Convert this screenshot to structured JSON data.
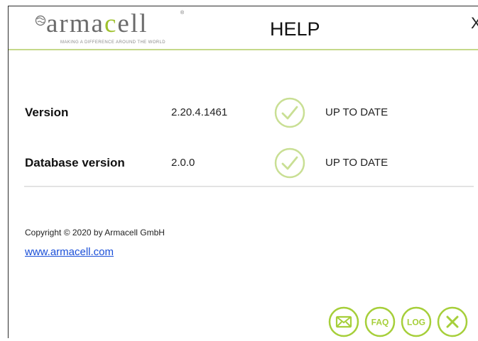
{
  "brand": {
    "name_prefix": "arma",
    "name_accent": "c",
    "name_suffix": "ell",
    "registered": "®",
    "tagline": "MAKING A DIFFERENCE AROUND THE WORLD"
  },
  "header": {
    "title": "HELP",
    "close_label": "X"
  },
  "versions": [
    {
      "label": "Version",
      "value": "2.20.4.1461",
      "status": "UP TO DATE",
      "icon": "check-circle-icon"
    },
    {
      "label": "Database version",
      "value": "2.0.0",
      "status": "UP TO DATE",
      "icon": "check-circle-icon"
    }
  ],
  "footer": {
    "copyright": "Copyright © 2020 by Armacell GmbH",
    "website": "www.armacell.com"
  },
  "actions": {
    "mail_icon": "envelope-icon",
    "faq_label": "FAQ",
    "log_label": "LOG",
    "close_icon": "close-icon"
  },
  "colors": {
    "accent": "#9fc12d",
    "icon_green": "#a6cf3a",
    "check_green": "#c9df94",
    "link": "#1a4fd8"
  }
}
